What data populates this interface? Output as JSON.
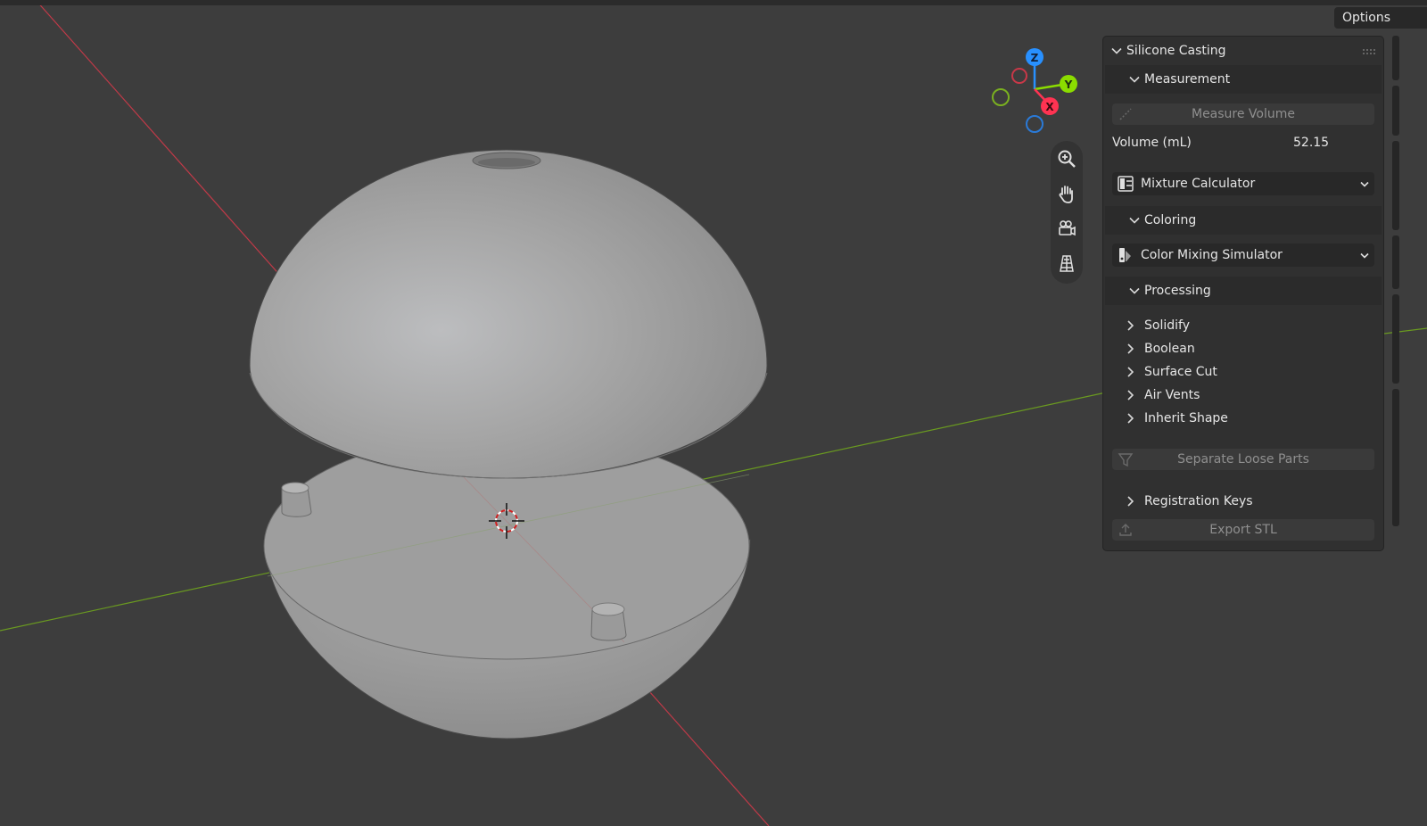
{
  "header": {
    "options_label": "Options"
  },
  "gizmo": {
    "z_label": "Z",
    "y_label": "Y",
    "x_label": "X"
  },
  "nav_tools": [
    {
      "name": "zoom-icon"
    },
    {
      "name": "hand-pan-icon"
    },
    {
      "name": "camera-view-icon"
    },
    {
      "name": "ortho-grid-icon"
    }
  ],
  "panel": {
    "title": "Silicone Casting",
    "measurement": {
      "title": "Measurement",
      "measure_button": "Measure Volume",
      "volume_label": "Volume (mL)",
      "volume_value": "52.15"
    },
    "mixture_dropdown": "Mixture Calculator",
    "coloring": {
      "title": "Coloring",
      "dropdown": "Color Mixing Simulator"
    },
    "processing": {
      "title": "Processing",
      "items": [
        "Solidify",
        "Boolean",
        "Surface Cut",
        "Air Vents",
        "Inherit Shape"
      ],
      "separate_button": "Separate Loose Parts",
      "registration_keys": "Registration Keys",
      "export_button": "Export STL"
    }
  },
  "colors": {
    "background": "#3d3d3d",
    "panel": "#303030",
    "x_axis": "#ff3352",
    "y_axis": "#8bdc00",
    "z_axis": "#2890ff"
  }
}
